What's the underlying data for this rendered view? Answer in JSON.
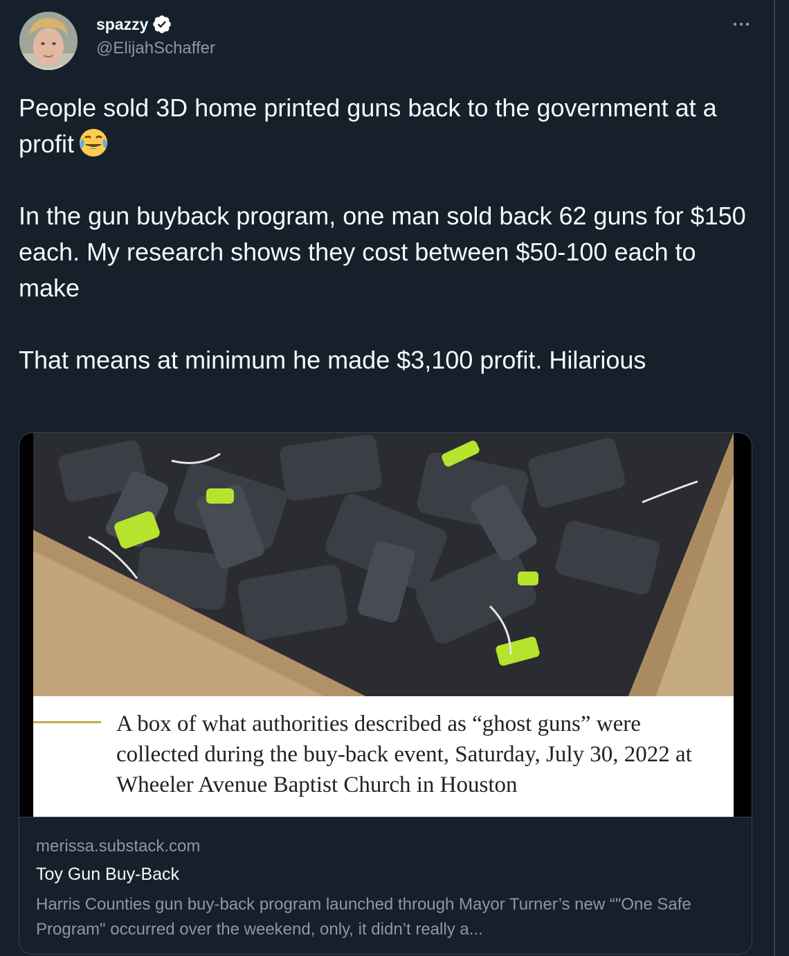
{
  "author": {
    "display_name": "spazzy",
    "handle": "@ElijahSchaffer",
    "verified": true,
    "avatar_icon": "profile-photo"
  },
  "tweet": {
    "paragraph_1": "People sold 3D home printed guns back to the government at a profit",
    "emoji": "face-with-tears-of-joy",
    "paragraph_2": "In the gun buyback program, one man sold back 62 guns for $150 each. My research shows they cost between $50-100 each to make",
    "paragraph_3": "That means at minimum he made $3,100 profit. Hilarious"
  },
  "link_card": {
    "image_caption": "A box of what authorities described as “ghost guns” were collected during the buy-back event, Saturday, July 30, 2022 at Wheeler Avenue Baptist Church in Houston",
    "domain": "merissa.substack.com",
    "title": "Toy Gun Buy-Back",
    "description": "Harris Counties gun buy-back program launched through Mayor Turner’s new “\"One Safe Program\" occurred over the weekend, only, it didn’t really a..."
  },
  "colors": {
    "background": "#15202b",
    "text_primary": "#f7f9f9",
    "text_secondary": "#8b98a5",
    "border": "#38444d",
    "verified_badge": "#ffffff",
    "caption_rule": "#c9a84a"
  }
}
